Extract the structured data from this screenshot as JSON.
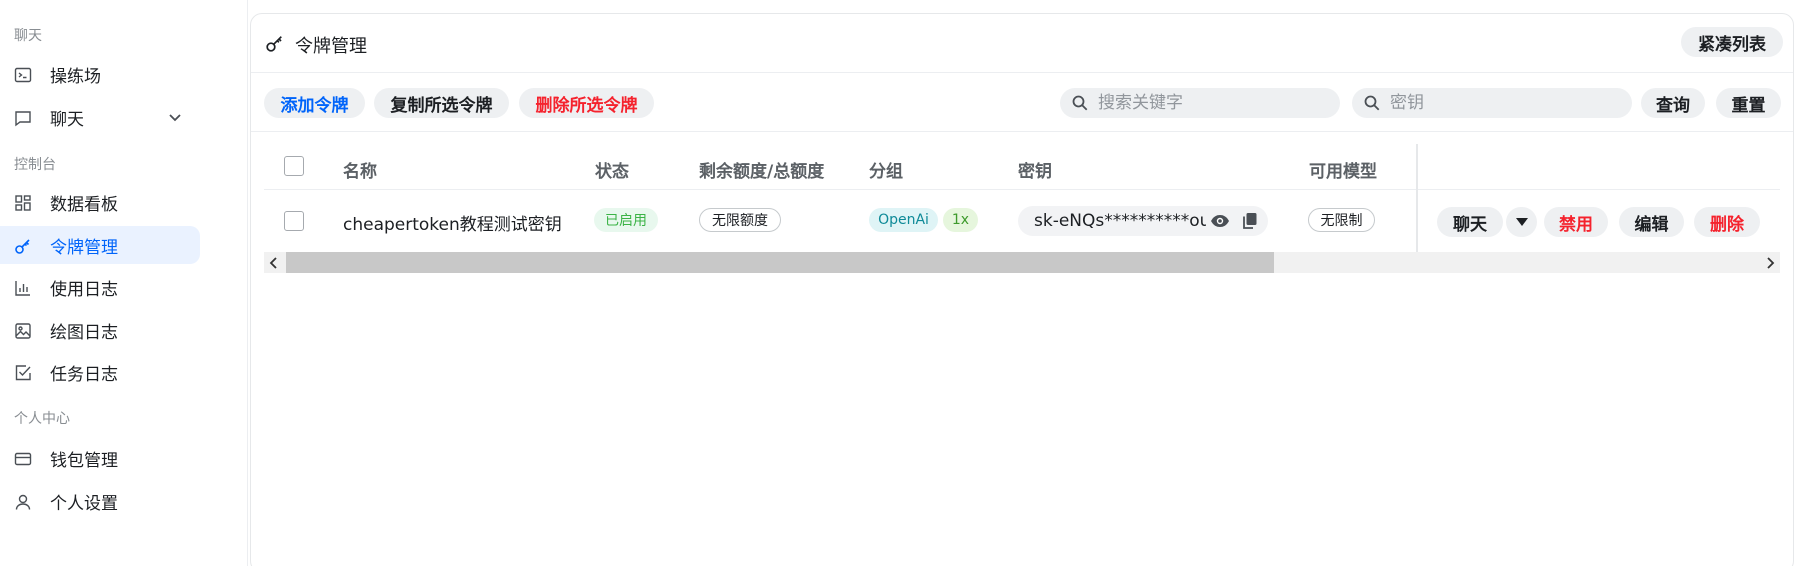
{
  "sidebar": {
    "sections": [
      "聊天",
      "控制台",
      "个人中心"
    ],
    "items": [
      {
        "label": "操练场",
        "icon": "terminal-icon"
      },
      {
        "label": "聊天",
        "icon": "chat-icon"
      },
      {
        "label": "数据看板",
        "icon": "dashboard-icon"
      },
      {
        "label": "令牌管理",
        "icon": "key-icon",
        "active": true
      },
      {
        "label": "使用日志",
        "icon": "bar-chart-icon"
      },
      {
        "label": "绘图日志",
        "icon": "image-icon"
      },
      {
        "label": "任务日志",
        "icon": "checkbox-icon"
      },
      {
        "label": "钱包管理",
        "icon": "credit-card-icon"
      },
      {
        "label": "个人设置",
        "icon": "user-icon"
      }
    ]
  },
  "header": {
    "title": "令牌管理",
    "compact_button": "紧凑列表"
  },
  "toolbar": {
    "add": "添加令牌",
    "copy_selected": "复制所选令牌",
    "delete_selected": "删除所选令牌",
    "search_placeholder": "搜索关键字",
    "key_placeholder": "密钥",
    "query": "查询",
    "reset": "重置"
  },
  "table": {
    "columns": [
      "名称",
      "状态",
      "剩余额度/总额度",
      "分组",
      "密钥",
      "可用模型"
    ],
    "rows": [
      {
        "name": "cheapertoken教程测试密钥",
        "status": "已启用",
        "quota": "无限额度",
        "group": "OpenAi",
        "ratio": "1x",
        "key": "sk-eNQs**********ouKp",
        "models": "无限制",
        "actions": {
          "chat": "聊天",
          "disable": "禁用",
          "edit": "编辑",
          "delete": "删除"
        }
      }
    ]
  },
  "colors": {
    "accent": "#0064fa",
    "danger": "#f5222d",
    "active_bg": "#eaf2ff"
  }
}
